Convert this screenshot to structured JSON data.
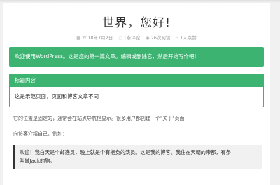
{
  "post": {
    "title": "世界，您好!",
    "meta": {
      "date": "2018年7月2日",
      "comments": "1条评论",
      "views": "26次阅读",
      "likes": "1人点赞"
    },
    "welcome_alert": "欢迎使用WordPress。这是您的第一篇文章。编辑或删除它，然后开始写作吧!",
    "panel": {
      "title": "标题内容",
      "body": "这是示范页面，页面和博客文章不同"
    },
    "paragraph_1": "它的位置是固定的，通常会在站点导航栏显示。很多用户都创建一个\"关于\"页面",
    "paragraph_2": "向访客介绍自己。例如：",
    "quote_line_1": "欢迎！我白天是个邮递员，晚上就是个有抱负的演员。这是我的博客。我住在天朝的帝都，有条",
    "quote_line_2": "叫做Jack的狗。"
  },
  "colors": {
    "accent_green": "#3cb371",
    "quote_border": "#333333"
  },
  "icons": {
    "date": "calendar-icon",
    "comments": "comment-icon",
    "views": "eye-icon",
    "likes": "thumbs-up-icon"
  }
}
